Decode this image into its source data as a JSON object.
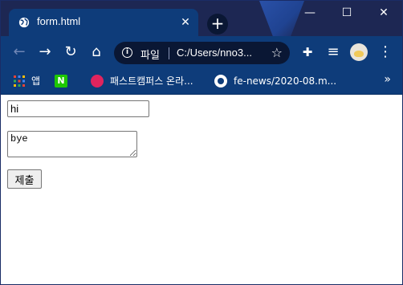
{
  "tab": {
    "title": "form.html"
  },
  "window_controls": {
    "minimize": "—",
    "maximize": "☐",
    "close": "✕"
  },
  "new_tab_label": "+",
  "toolbar": {
    "back": "←",
    "forward": "→",
    "reload": "↻",
    "home": "⌂",
    "url_scheme": "파일",
    "url": "C:/Users/nno3...",
    "star": "☆",
    "extensions": "✚",
    "media": "≡",
    "menu": "⋮"
  },
  "bookmarks": {
    "apps_label": "앱",
    "items": [
      {
        "icon": "naver-icon",
        "label": ""
      },
      {
        "icon": "fastcampus-icon",
        "label": "패스트캠퍼스 온라..."
      },
      {
        "icon": "github-icon",
        "label": "fe-news/2020-08.m..."
      }
    ],
    "more": "»"
  },
  "form": {
    "text_value": "hi",
    "textarea_value": "bye",
    "submit_label": "제출"
  }
}
